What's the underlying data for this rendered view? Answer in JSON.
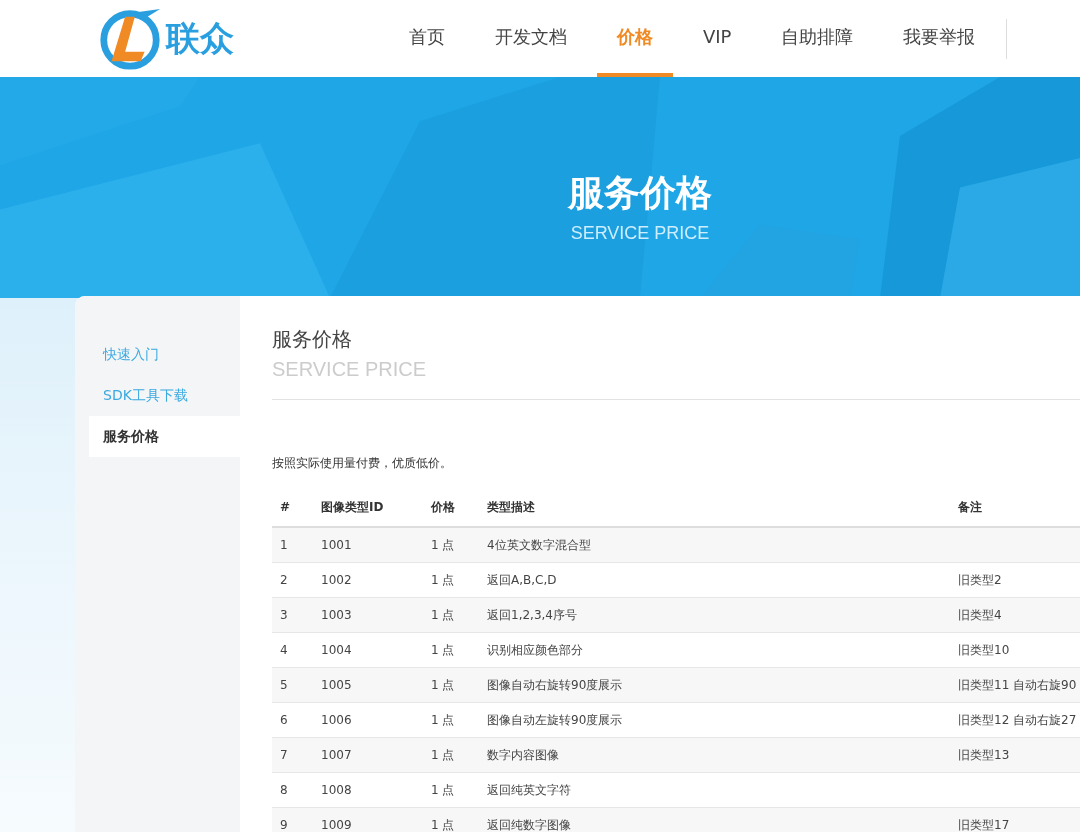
{
  "logo": {
    "text": "联众"
  },
  "nav": [
    {
      "label": "首页",
      "selected": false
    },
    {
      "label": "开发文档",
      "selected": false
    },
    {
      "label": "价格",
      "selected": true
    },
    {
      "label": "VIP",
      "selected": false
    },
    {
      "label": "自助排障",
      "selected": false
    },
    {
      "label": "我要举报",
      "selected": false
    }
  ],
  "hero": {
    "title": "服务价格",
    "subtitle": "SERVICE PRICE"
  },
  "sidebar": {
    "items": [
      {
        "label": "快速入门",
        "selected": false
      },
      {
        "label": "SDK工具下载",
        "selected": false
      },
      {
        "label": "服务价格",
        "selected": true
      }
    ]
  },
  "content": {
    "title": "服务价格",
    "subtitle": "SERVICE PRICE",
    "intro": "按照实际使用量付费，优质低价。"
  },
  "table": {
    "columns": [
      "#",
      "图像类型ID",
      "价格",
      "类型描述",
      "备注"
    ],
    "rows": [
      [
        "1",
        "1001",
        "1 点",
        "4位英文数字混合型",
        ""
      ],
      [
        "2",
        "1002",
        "1 点",
        "返回A,B,C,D",
        "旧类型2"
      ],
      [
        "3",
        "1003",
        "1 点",
        "返回1,2,3,4序号",
        "旧类型4"
      ],
      [
        "4",
        "1004",
        "1 点",
        "识别相应颜色部分",
        "旧类型10"
      ],
      [
        "5",
        "1005",
        "1 点",
        "图像自动右旋转90度展示",
        "旧类型11 自动右旋90"
      ],
      [
        "6",
        "1006",
        "1 点",
        "图像自动左旋转90度展示",
        "旧类型12 自动右旋27"
      ],
      [
        "7",
        "1007",
        "1 点",
        "数字内容图像",
        "旧类型13"
      ],
      [
        "8",
        "1008",
        "1 点",
        "返回纯英文字符",
        ""
      ],
      [
        "9",
        "1009",
        "1 点",
        "返回纯数字图像",
        "旧类型17"
      ]
    ]
  }
}
